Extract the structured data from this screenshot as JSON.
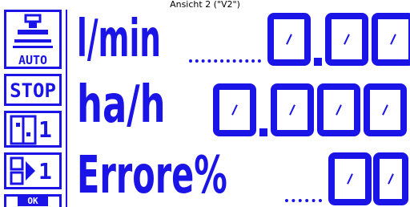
{
  "header": {
    "title": "Ansicht 2 (\"V2\")"
  },
  "sidebar": {
    "mode_label": "AUTO",
    "stop_label": "STOP",
    "section_count": "1",
    "boom_count": "1",
    "bottom_label": "OK"
  },
  "readouts": [
    {
      "unit": "l/min",
      "value": "0.00"
    },
    {
      "unit": "ha/h",
      "value": "0.000"
    },
    {
      "unit": "Errore%",
      "value": "00"
    }
  ],
  "colors": {
    "lcd_blue": "#1a14e6",
    "background": "#ffffff"
  }
}
